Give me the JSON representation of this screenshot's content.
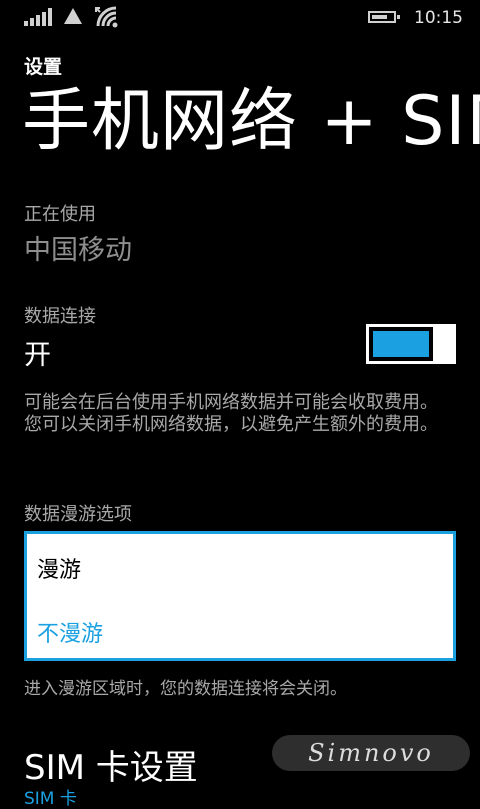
{
  "status_bar": {
    "time": "10:15",
    "icons": [
      "signal-icon",
      "data-triangle-icon",
      "wifi-icon",
      "battery-icon"
    ],
    "battery_level": 0.75
  },
  "header": {
    "app_label": "设置",
    "page_title": "手机网络 + SIM"
  },
  "in_use": {
    "label": "正在使用",
    "value": "中国移动"
  },
  "data_connection": {
    "label": "数据连接",
    "value": "开",
    "toggle_on": true,
    "description": "可能会在后台使用手机网络数据并可能会收取费用。您可以关闭手机网络数据，以避免产生额外的费用。"
  },
  "roaming": {
    "label": "数据漫游选项",
    "options": [
      "漫游",
      "不漫游"
    ],
    "selected": "不漫游",
    "note": "进入漫游区域时，您的数据连接将会关闭。"
  },
  "sim_settings": {
    "title": "SIM 卡设置",
    "subtitle": "SIM 卡"
  },
  "watermark": "Simnovo",
  "colors": {
    "accent": "#1ba1e2",
    "background": "#000000",
    "foreground": "#ffffff",
    "secondary_text": "#a8a8a8"
  }
}
